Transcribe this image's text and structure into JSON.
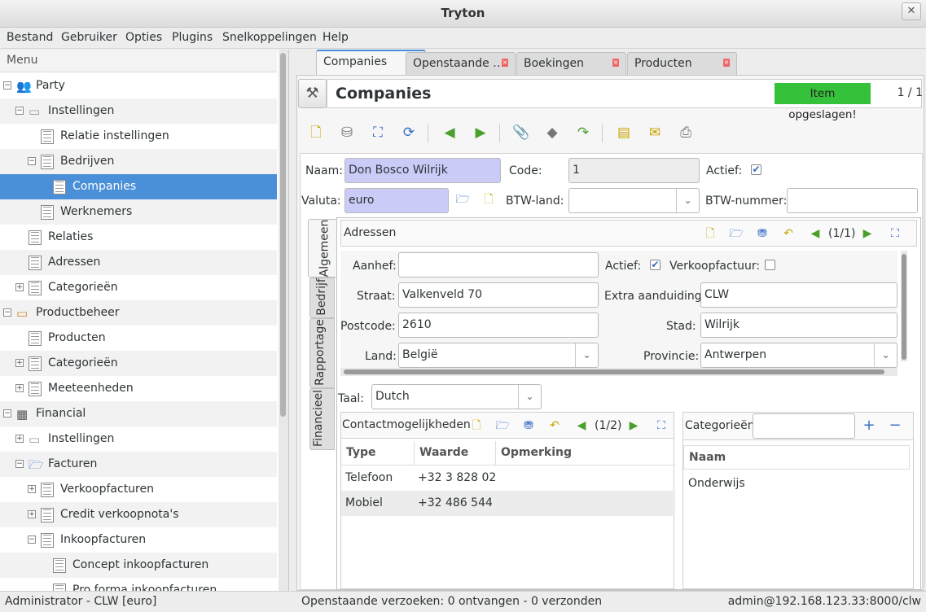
{
  "window": {
    "title": "Tryton"
  },
  "menubar": [
    "Bestand",
    "Gebruiker",
    "Opties",
    "Plugins",
    "Snelkoppelingen",
    "Help"
  ],
  "menu": {
    "header": "Menu",
    "items": [
      {
        "label": "Party",
        "icon": "party-icon",
        "expander": "−",
        "depth": 0
      },
      {
        "label": "Instellingen",
        "icon": "settings-tray-icon",
        "expander": "−",
        "depth": 1
      },
      {
        "label": "Relatie instellingen",
        "icon": "document-icon",
        "expander": "",
        "depth": 2
      },
      {
        "label": "Bedrijven",
        "icon": "document-icon",
        "expander": "−",
        "depth": 2
      },
      {
        "label": "Companies",
        "icon": "document-icon",
        "expander": "",
        "depth": 3,
        "selected": true
      },
      {
        "label": "Werknemers",
        "icon": "document-icon",
        "expander": "",
        "depth": 2
      },
      {
        "label": "Relaties",
        "icon": "document-icon",
        "expander": "",
        "depth": 1
      },
      {
        "label": "Adressen",
        "icon": "document-icon",
        "expander": "",
        "depth": 1
      },
      {
        "label": "Categorieën",
        "icon": "document-icon",
        "expander": "+",
        "depth": 1
      },
      {
        "label": "Productbeheer",
        "icon": "product-box-icon",
        "expander": "−",
        "depth": 0
      },
      {
        "label": "Producten",
        "icon": "document-icon",
        "expander": "",
        "depth": 1
      },
      {
        "label": "Categorieën",
        "icon": "document-icon",
        "expander": "+",
        "depth": 1
      },
      {
        "label": "Meeteenheden",
        "icon": "document-icon",
        "expander": "+",
        "depth": 1
      },
      {
        "label": "Financial",
        "icon": "calculator-icon",
        "expander": "−",
        "depth": 0
      },
      {
        "label": "Instellingen",
        "icon": "settings-tray-icon",
        "expander": "+",
        "depth": 1
      },
      {
        "label": "Facturen",
        "icon": "folder-open-icon",
        "expander": "−",
        "depth": 1
      },
      {
        "label": "Verkoopfacturen",
        "icon": "document-icon",
        "expander": "+",
        "depth": 2
      },
      {
        "label": "Credit verkoopnota's",
        "icon": "document-icon",
        "expander": "+",
        "depth": 2
      },
      {
        "label": "Inkoopfacturen",
        "icon": "document-icon",
        "expander": "−",
        "depth": 2
      },
      {
        "label": "Concept inkoopfacturen",
        "icon": "document-icon",
        "expander": "",
        "depth": 3
      },
      {
        "label": "Pro forma inkoopfacturen",
        "icon": "document-icon",
        "expander": "",
        "depth": 3
      }
    ]
  },
  "tabs": [
    "Companies",
    "Openstaande …",
    "Boekingen",
    "Producten"
  ],
  "form": {
    "title": "Companies",
    "saved_message": "Item opgeslagen!",
    "record_counter": "1 / 1",
    "naam_label": "Naam:",
    "naam_value": "Don Bosco Wilrijk",
    "code_label": "Code:",
    "code_value": "1",
    "actief_label": "Actief:",
    "valuta_label": "Valuta:",
    "valuta_value": "euro",
    "btw_land_label": "BTW-land:",
    "btw_land_value": "",
    "btw_nummer_label": "BTW-nummer:",
    "btw_nummer_value": "",
    "vertical_tabs": [
      "Algemeen",
      "Bedrijf",
      "Rapportage",
      "Financieel"
    ],
    "addresses": {
      "title": "Adressen",
      "counter": "(1/1)",
      "aanhef_label": "Aanhef:",
      "aanhef_value": "",
      "actief_label": "Actief:",
      "verkoopfactuur_label": "Verkoopfactuur:",
      "straat_label": "Straat:",
      "straat_value": "Valkenveld 70",
      "extra_label": "Extra aanduiding:",
      "extra_value": "CLW",
      "postcode_label": "Postcode:",
      "postcode_value": "2610",
      "stad_label": "Stad:",
      "stad_value": "Wilrijk",
      "land_label": "Land:",
      "land_value": "België",
      "provincie_label": "Provincie:",
      "provincie_value": "Antwerpen"
    },
    "taal_label": "Taal:",
    "taal_value": "Dutch",
    "contacts": {
      "title": "Contactmogelijkheden",
      "counter": "(1/2)",
      "columns": [
        "Type",
        "Waarde",
        "Opmerking"
      ],
      "rows": [
        {
          "type": "Telefoon",
          "value": "+32 3 828 02",
          "note": ""
        },
        {
          "type": "Mobiel",
          "value": "+32 486 544",
          "note": ""
        }
      ]
    },
    "categories": {
      "title": "Categorieën",
      "search_value": "",
      "column": "Naam",
      "rows": [
        "Onderwijs"
      ]
    }
  },
  "status": {
    "left": "Administrator - CLW [euro]",
    "center": "Openstaande verzoeken: 0 ontvangen - 0 verzonden",
    "right": "admin@192.168.123.33:8000/clw"
  },
  "colors": {
    "accent": "#4a90d9",
    "saved": "#36c13a",
    "required": "#cbcbf7"
  }
}
